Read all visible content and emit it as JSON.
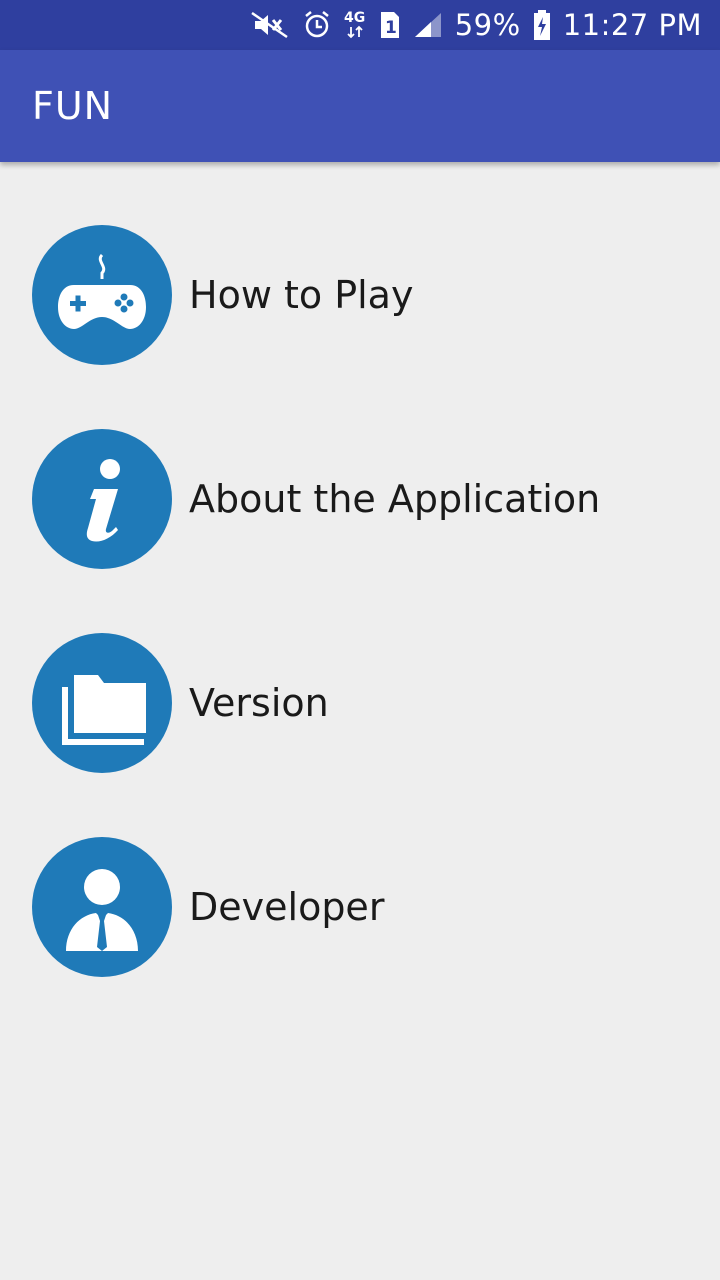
{
  "status_bar": {
    "battery": "59%",
    "time": "11:27 PM",
    "network": "4G",
    "sim": "1",
    "icons": [
      "mute-icon",
      "alarm-icon",
      "network-4g-icon",
      "sim-1-icon",
      "signal-icon",
      "battery-charging-icon"
    ]
  },
  "app_bar": {
    "title": "FUN"
  },
  "menu": {
    "items": [
      {
        "label": "How to Play",
        "icon": "gamepad-icon"
      },
      {
        "label": "About the Application",
        "icon": "info-icon"
      },
      {
        "label": "Version",
        "icon": "folder-icon"
      },
      {
        "label": "Developer",
        "icon": "person-icon"
      }
    ]
  },
  "colors": {
    "status_bar": "#2f3f9f",
    "app_bar": "#3f51b5",
    "background": "#eeeeee",
    "icon_circle": "#1f7ab8",
    "icon_glyph": "#ffffff",
    "label_text": "#1a1a1a"
  }
}
